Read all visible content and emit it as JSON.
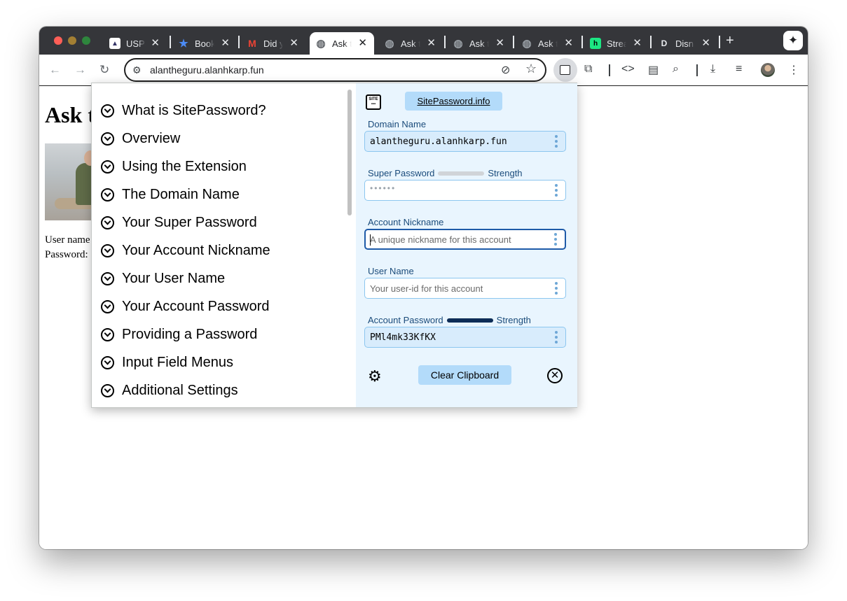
{
  "browser": {
    "tabs": [
      {
        "title": "USPS",
        "icon": "usps-eagle-icon",
        "active": false
      },
      {
        "title": "Book",
        "icon": "star-icon",
        "active": false
      },
      {
        "title": "Did y",
        "icon": "gmail-icon",
        "active": false
      },
      {
        "title": "Ask t",
        "icon": "globe-icon",
        "active": true
      },
      {
        "title": "Ask t",
        "icon": "globe-icon",
        "active": false
      },
      {
        "title": "Ask t",
        "icon": "globe-icon",
        "active": false
      },
      {
        "title": "Ask t",
        "icon": "globe-icon",
        "active": false
      },
      {
        "title": "Strea",
        "icon": "hulu-h-icon",
        "active": false
      },
      {
        "title": "Disn",
        "icon": "disney-icon",
        "active": false
      }
    ],
    "url": "alantheguru.alanhkarp.fun"
  },
  "page": {
    "title": "Ask t",
    "user_label": "User name",
    "password_label": "Password:"
  },
  "help": {
    "items": [
      "What is SitePassword?",
      "Overview",
      "Using the Extension",
      "The Domain Name",
      "Your Super Password",
      "Your Account Nickname",
      "Your User Name",
      "Your Account Password",
      "Providing a Password",
      "Input Field Menus",
      "Additional Settings"
    ]
  },
  "sitepassword": {
    "logo_text": "SITE",
    "link_label": "SitePassword.info",
    "domain_label": "Domain Name",
    "domain_value": "alantheguru.alanhkarp.fun",
    "super_label": "Super Password",
    "super_strength_label": "Strength",
    "super_value_masked": "••••••",
    "nickname_label": "Account Nickname",
    "nickname_placeholder": "A unique nickname for this account",
    "username_label": "User Name",
    "username_placeholder": "Your user-id for this account",
    "password_label": "Account Password",
    "password_strength_label": "Strength",
    "password_value": "PMl4mk33KfKX",
    "clear_label": "Clear Clipboard"
  },
  "colors": {
    "accent": "#b3dbfa",
    "panel_bg": "#e9f5fe",
    "label": "#1a4b7a",
    "strong_strength": "#0d2d57"
  }
}
